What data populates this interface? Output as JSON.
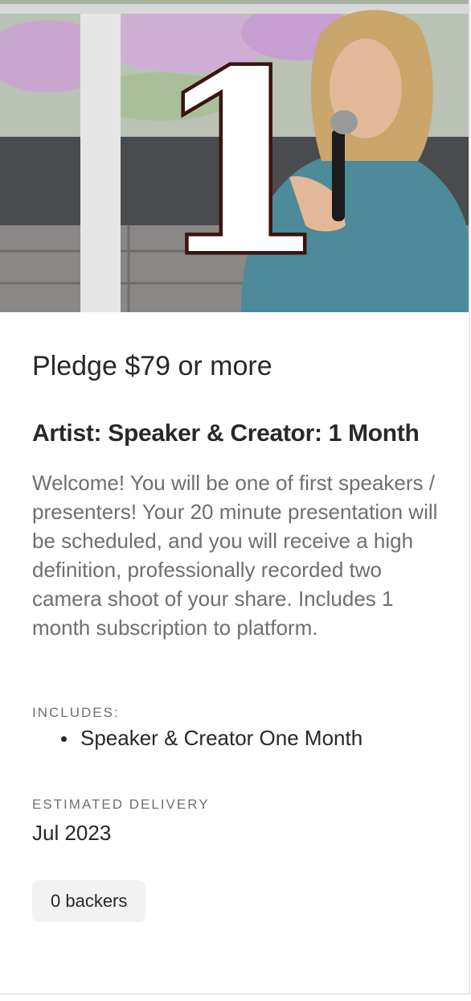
{
  "hero": {
    "image_description_icon": "photo-speaker-with-microphone",
    "badge_number": "1"
  },
  "reward": {
    "pledge_text": "Pledge $79 or more",
    "title": "Artist: Speaker & Creator: 1 Month",
    "description": "Welcome! You will be one of first speakers / presenters! Your 20 minute presentation will be scheduled, and you will receive a high definition, professionally recorded two camera shoot of your share. Includes 1 month subscription to platform.",
    "includes_label": "INCLUDES:",
    "includes_items": [
      "Speaker & Creator One Month"
    ],
    "delivery_label": "ESTIMATED DELIVERY",
    "delivery_value": "Jul 2023",
    "backers_text": "0 backers"
  },
  "colors": {
    "text_primary": "#282828",
    "text_secondary": "#6f6f6f",
    "badge_bg": "#f2f2f2",
    "numeral_outline": "#3a1410"
  }
}
